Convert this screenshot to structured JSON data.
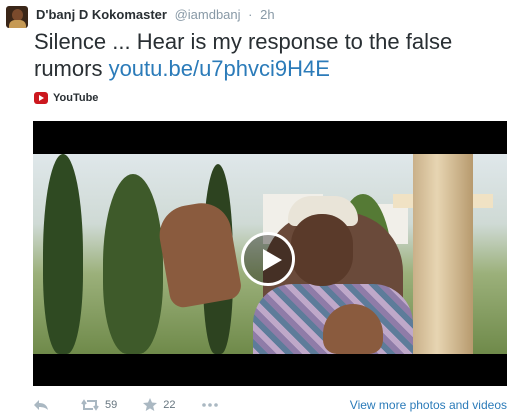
{
  "tweet": {
    "fullname": "D'banj D Kokomaster",
    "username": "@iamdbanj",
    "separator": "·",
    "time": "2h",
    "text": "Silence ... Hear is my response to the false rumors ",
    "link": "youtu.be/u7phvci9H4E"
  },
  "card": {
    "provider": "YouTube",
    "provider_icon": "youtube-icon",
    "play_icon": "play-icon"
  },
  "actions": {
    "retweets": "59",
    "favorites": "22",
    "view_more": "View more photos and videos"
  },
  "colors": {
    "link": "#2b7bb9",
    "muted": "#8899a6",
    "youtube_red": "#cc181e"
  }
}
